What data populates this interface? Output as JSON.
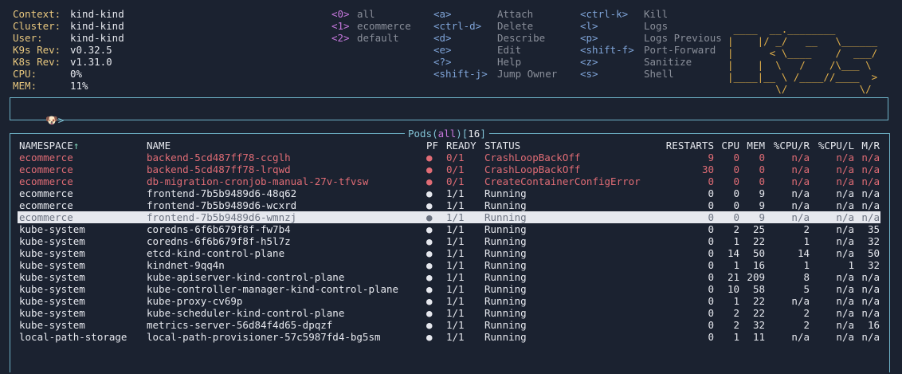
{
  "info": [
    {
      "label": "Context:",
      "value": "kind-kind"
    },
    {
      "label": "Cluster:",
      "value": "kind-kind"
    },
    {
      "label": "User:",
      "value": "kind-kind"
    },
    {
      "label": "K9s Rev:",
      "value": "v0.32.5"
    },
    {
      "label": "K8s Rev:",
      "value": "v1.31.0"
    },
    {
      "label": "CPU:",
      "value": "0%"
    },
    {
      "label": "MEM:",
      "value": "11%"
    }
  ],
  "namespaces": [
    {
      "key": "<0>",
      "name": "all"
    },
    {
      "key": "<1>",
      "name": "ecommerce"
    },
    {
      "key": "<2>",
      "name": "default"
    }
  ],
  "shortcuts_col1": [
    {
      "key": "<a>",
      "name": "Attach"
    },
    {
      "key": "<ctrl-d>",
      "name": "Delete"
    },
    {
      "key": "<d>",
      "name": "Describe"
    },
    {
      "key": "<e>",
      "name": "Edit"
    },
    {
      "key": "<?>",
      "name": "Help"
    },
    {
      "key": "<shift-j>",
      "name": "Jump Owner"
    }
  ],
  "shortcuts_col2": [
    {
      "key": "<ctrl-k>",
      "name": "Kill"
    },
    {
      "key": "<l>",
      "name": "Logs"
    },
    {
      "key": "<p>",
      "name": "Logs Previous"
    },
    {
      "key": "<shift-f>",
      "name": "Port-Forward"
    },
    {
      "key": "<z>",
      "name": "Sanitize"
    },
    {
      "key": "<s>",
      "name": "Shell"
    }
  ],
  "logo_lines": [
    " ____  __.________       ",
    "|    |/ _/   __   \\______",
    "|      < \\____    /  ___/",
    "|    |  \\   /    /\\___ \\ ",
    "|____|__ \\ /____//____  >",
    "        \\/            \\/ "
  ],
  "prompt": {
    "icon": "dog-icon",
    "symbol": ">"
  },
  "pods_title": {
    "prefix": "Pods(",
    "ns": "all",
    "mid": ")[",
    "count": "16",
    "suffix": "]"
  },
  "headers": [
    "NAMESPACE↑",
    "NAME",
    "PF",
    "READY",
    "STATUS",
    "RESTARTS",
    "CPU",
    "MEM",
    "%CPU/R",
    "%CPU/L",
    "M/R"
  ],
  "pods": [
    {
      "ns": "ecommerce",
      "name": "backend-5cd487ff78-ccglh",
      "pf": "●",
      "ready": "0/1",
      "status": "CrashLoopBackOff",
      "restarts": "9",
      "cpu": "0",
      "mem": "0",
      "cpur": "n/a",
      "cpul": "n/a",
      "mr": "n/a",
      "state": "error"
    },
    {
      "ns": "ecommerce",
      "name": "backend-5cd487ff78-lrqwd",
      "pf": "●",
      "ready": "0/1",
      "status": "CrashLoopBackOff",
      "restarts": "30",
      "cpu": "0",
      "mem": "0",
      "cpur": "n/a",
      "cpul": "n/a",
      "mr": "n/a",
      "state": "error"
    },
    {
      "ns": "ecommerce",
      "name": "db-migration-cronjob-manual-27v-tfvsw",
      "pf": "●",
      "ready": "0/1",
      "status": "CreateContainerConfigError",
      "restarts": "0",
      "cpu": "0",
      "mem": "0",
      "cpur": "n/a",
      "cpul": "n/a",
      "mr": "n/a",
      "state": "error"
    },
    {
      "ns": "ecommerce",
      "name": "frontend-7b5b9489d6-48q62",
      "pf": "●",
      "ready": "1/1",
      "status": "Running",
      "restarts": "0",
      "cpu": "0",
      "mem": "9",
      "cpur": "n/a",
      "cpul": "n/a",
      "mr": "n/a",
      "state": "ok"
    },
    {
      "ns": "ecommerce",
      "name": "frontend-7b5b9489d6-wcxrd",
      "pf": "●",
      "ready": "1/1",
      "status": "Running",
      "restarts": "0",
      "cpu": "0",
      "mem": "9",
      "cpur": "n/a",
      "cpul": "n/a",
      "mr": "n/a",
      "state": "ok"
    },
    {
      "ns": "ecommerce",
      "name": "frontend-7b5b9489d6-wmnzj",
      "pf": "●",
      "ready": "1/1",
      "status": "Running",
      "restarts": "0",
      "cpu": "0",
      "mem": "9",
      "cpur": "n/a",
      "cpul": "n/a",
      "mr": "n/a",
      "state": "selected"
    },
    {
      "ns": "kube-system",
      "name": "coredns-6f6b679f8f-fw7b4",
      "pf": "●",
      "ready": "1/1",
      "status": "Running",
      "restarts": "0",
      "cpu": "2",
      "mem": "25",
      "cpur": "2",
      "cpul": "n/a",
      "mr": "35",
      "state": "ok"
    },
    {
      "ns": "kube-system",
      "name": "coredns-6f6b679f8f-h5l7z",
      "pf": "●",
      "ready": "1/1",
      "status": "Running",
      "restarts": "0",
      "cpu": "1",
      "mem": "22",
      "cpur": "1",
      "cpul": "n/a",
      "mr": "32",
      "state": "ok"
    },
    {
      "ns": "kube-system",
      "name": "etcd-kind-control-plane",
      "pf": "●",
      "ready": "1/1",
      "status": "Running",
      "restarts": "0",
      "cpu": "14",
      "mem": "50",
      "cpur": "14",
      "cpul": "n/a",
      "mr": "50",
      "state": "ok"
    },
    {
      "ns": "kube-system",
      "name": "kindnet-9qq4n",
      "pf": "●",
      "ready": "1/1",
      "status": "Running",
      "restarts": "0",
      "cpu": "1",
      "mem": "16",
      "cpur": "1",
      "cpul": "1",
      "mr": "32",
      "state": "ok"
    },
    {
      "ns": "kube-system",
      "name": "kube-apiserver-kind-control-plane",
      "pf": "●",
      "ready": "1/1",
      "status": "Running",
      "restarts": "0",
      "cpu": "21",
      "mem": "209",
      "cpur": "8",
      "cpul": "n/a",
      "mr": "n/a",
      "state": "ok"
    },
    {
      "ns": "kube-system",
      "name": "kube-controller-manager-kind-control-plane",
      "pf": "●",
      "ready": "1/1",
      "status": "Running",
      "restarts": "0",
      "cpu": "10",
      "mem": "58",
      "cpur": "5",
      "cpul": "n/a",
      "mr": "n/a",
      "state": "ok"
    },
    {
      "ns": "kube-system",
      "name": "kube-proxy-cv69p",
      "pf": "●",
      "ready": "1/1",
      "status": "Running",
      "restarts": "0",
      "cpu": "1",
      "mem": "22",
      "cpur": "n/a",
      "cpul": "n/a",
      "mr": "n/a",
      "state": "ok"
    },
    {
      "ns": "kube-system",
      "name": "kube-scheduler-kind-control-plane",
      "pf": "●",
      "ready": "1/1",
      "status": "Running",
      "restarts": "0",
      "cpu": "2",
      "mem": "22",
      "cpur": "2",
      "cpul": "n/a",
      "mr": "n/a",
      "state": "ok"
    },
    {
      "ns": "kube-system",
      "name": "metrics-server-56d84f4d65-dpqzf",
      "pf": "●",
      "ready": "1/1",
      "status": "Running",
      "restarts": "0",
      "cpu": "2",
      "mem": "32",
      "cpur": "2",
      "cpul": "n/a",
      "mr": "16",
      "state": "ok"
    },
    {
      "ns": "local-path-storage",
      "name": "local-path-provisioner-57c5987fd4-bg5sm",
      "pf": "●",
      "ready": "1/1",
      "status": "Running",
      "restarts": "0",
      "cpu": "1",
      "mem": "11",
      "cpur": "n/a",
      "cpul": "n/a",
      "mr": "n/a",
      "state": "ok"
    }
  ],
  "colors": {
    "background": "#1b2230",
    "error": "#e06c75",
    "selected_bg": "#e6e8ee",
    "border": "#6fb3c8",
    "key": "#c678dd",
    "shortcut_key": "#7fa4d8",
    "info_label": "#e8c77e",
    "logo": "#e2b04a"
  }
}
